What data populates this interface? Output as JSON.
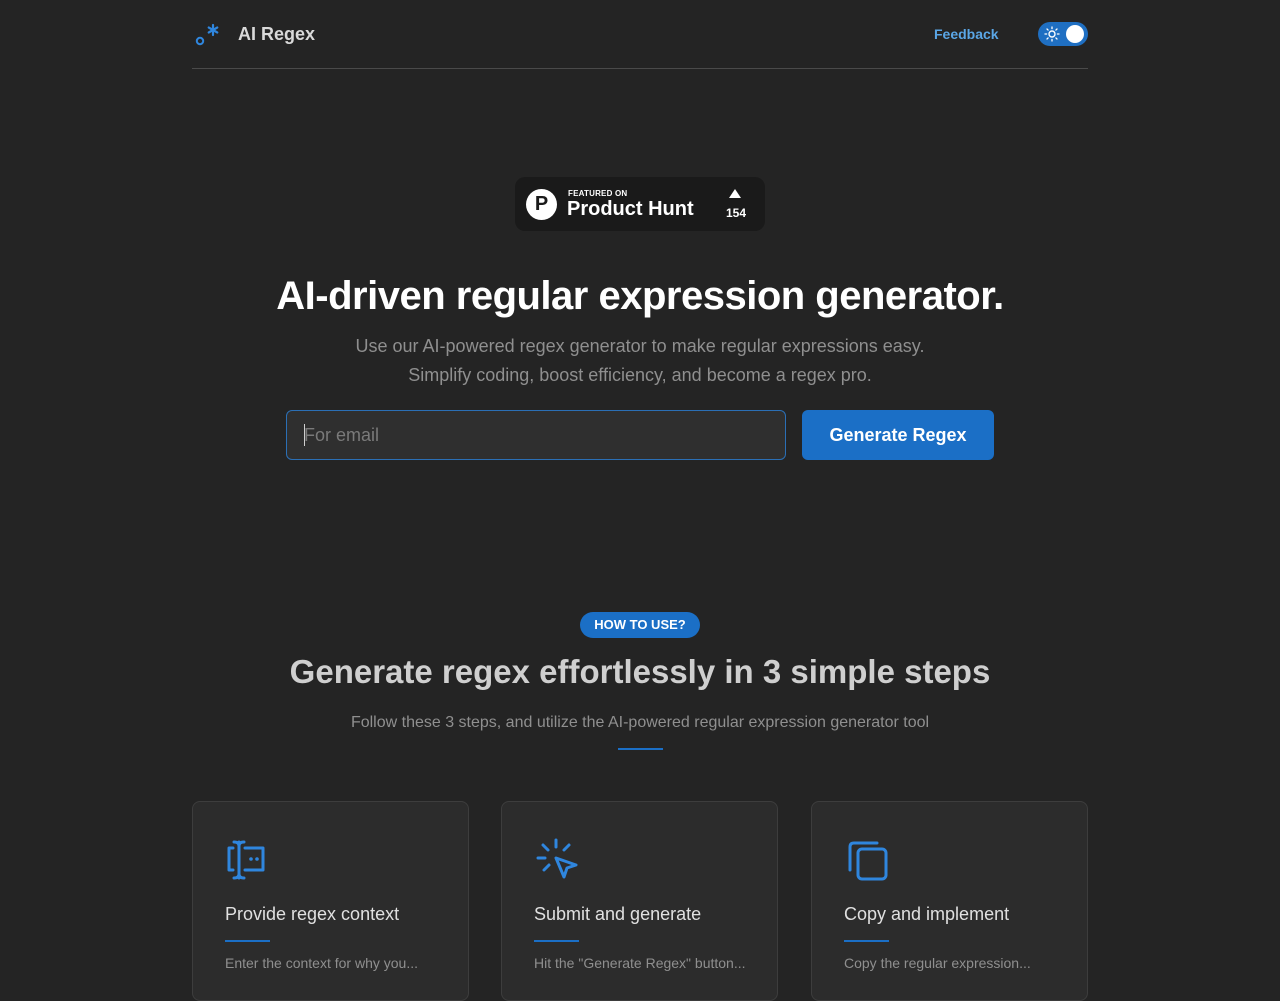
{
  "header": {
    "brand": "AI Regex",
    "feedback_label": "Feedback",
    "logo_icon": "regex-logo-icon",
    "theme_toggle_icon": "sun-icon"
  },
  "product_hunt": {
    "featured_on": "FEATURED ON",
    "name": "Product Hunt",
    "upvotes": "154",
    "logo_letter": "P"
  },
  "hero": {
    "title": "AI-driven regular expression generator.",
    "subtitle_line1": "Use our AI-powered regex generator to make regular expressions easy.",
    "subtitle_line2": "Simplify coding, boost efficiency, and become a regex pro.",
    "input_placeholder": "For email",
    "input_value": "",
    "button_label": "Generate Regex"
  },
  "how_to_use": {
    "badge": "HOW TO USE?",
    "title": "Generate regex effortlessly in 3 simple steps",
    "subtitle": "Follow these 3 steps, and utilize the AI-powered regular expression generator tool"
  },
  "steps": [
    {
      "icon": "text-cursor-icon",
      "title": "Provide regex context",
      "description": "Enter the context for why you..."
    },
    {
      "icon": "pointer-click-icon",
      "title": "Submit and generate",
      "description": "Hit the \"Generate Regex\" button..."
    },
    {
      "icon": "copy-icon",
      "title": "Copy and implement",
      "description": "Copy the regular expression..."
    }
  ],
  "colors": {
    "background": "#242424",
    "accent": "#1b6fc6",
    "link": "#5aa6e6"
  }
}
